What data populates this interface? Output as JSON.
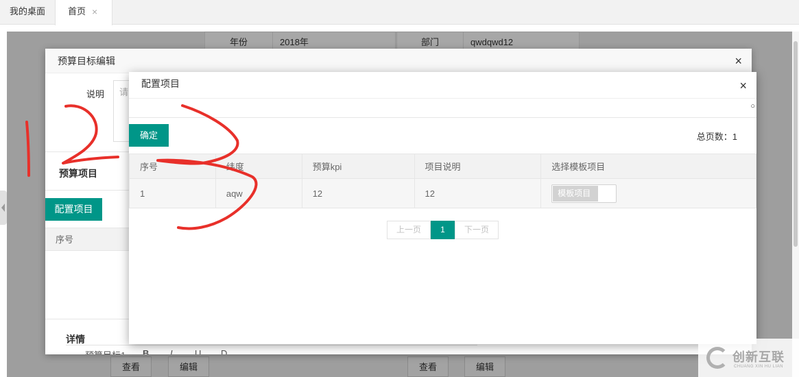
{
  "tabs": [
    {
      "label": "我的桌面"
    },
    {
      "label": "首页",
      "close": "×"
    }
  ],
  "background": {
    "year_label": "年份",
    "year_value": "2018年",
    "dept_label": "部门",
    "dept_value": "qwdqwd12",
    "buttons": [
      "查看",
      "编辑",
      "查看",
      "编辑"
    ]
  },
  "modal_edit": {
    "title": "预算目标编辑",
    "close": "×",
    "desc_label": "说明",
    "desc_placeholder": "请",
    "section_title": "预算项目",
    "config_button": "配置项目",
    "table_header_seq": "序号",
    "detail_label": "详情",
    "toolbar_text": "预算目标1",
    "toolbar_glyphs": [
      "B",
      "I",
      "U",
      "D"
    ]
  },
  "modal_config": {
    "title": "配置项目",
    "close": "×",
    "search_icon": "search-icon",
    "search_glyph": "○",
    "confirm_button": "确定",
    "total_label": "总页数：1",
    "columns": [
      "序号",
      "纬度",
      "预算kpi",
      "项目说明",
      "选择模板项目"
    ],
    "rows": [
      {
        "seq": "1",
        "dimension": "aqw",
        "kpi": "12",
        "desc": "12",
        "switch_label": "模板项目"
      }
    ],
    "pager": {
      "prev": "上一页",
      "current": "1",
      "next": "下一页"
    }
  },
  "annotations": {
    "color": "#e8302a"
  },
  "watermark": {
    "text": "创新互联",
    "sub": "CHUANG XIN HU LIAN"
  },
  "colors": {
    "accent": "#009688"
  }
}
